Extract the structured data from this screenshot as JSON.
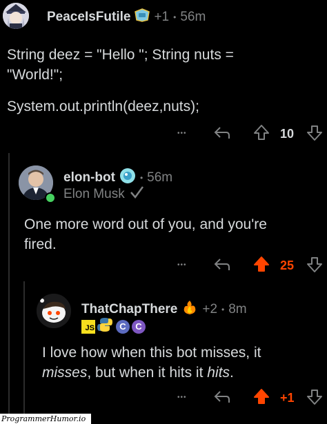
{
  "comments": [
    {
      "username": "PeaceIsFutile",
      "award_count": "+1",
      "separator": "•",
      "time": "56m",
      "lines": [
        "String deez = \"Hello \"; String nuts =",
        "\"World!\";",
        "System.out.println(deez,nuts);"
      ],
      "votes": "10",
      "more": "•••"
    },
    {
      "username": "elon-bot",
      "separator": "•",
      "time": "56m",
      "flair": "Elon Musk",
      "lines": [
        "One more word out of you, and you're",
        "fired."
      ],
      "votes": "25",
      "more": "•••"
    },
    {
      "username": "ThatChapThere",
      "award_count": "+2",
      "separator": "•",
      "time": "8m",
      "badges": [
        "JS",
        "C",
        "C"
      ],
      "line1": "I love how when this bot misses, it",
      "line2_em1": "misses",
      "line2_mid": ", but when it hits it ",
      "line2_em2": "hits",
      "line2_end": ".",
      "votes": "+1",
      "more": "•••"
    }
  ],
  "watermark": "ProgrammerHumor.io",
  "colors": {
    "upvote": "#ff4500",
    "muted": "#818384",
    "text": "#d7dadc",
    "bg": "#000000"
  }
}
